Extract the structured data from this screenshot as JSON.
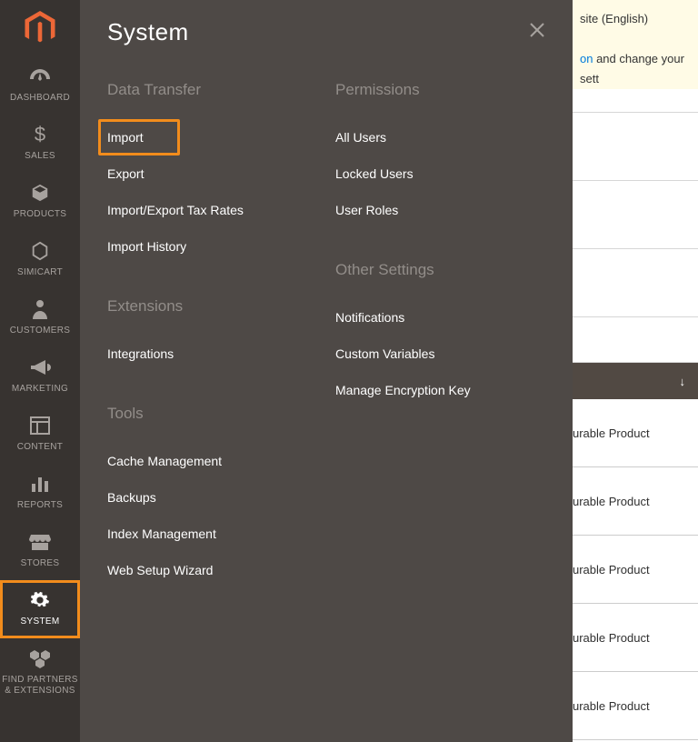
{
  "nav": {
    "items": [
      {
        "id": "dashboard",
        "label": "DASHBOARD"
      },
      {
        "id": "sales",
        "label": "SALES"
      },
      {
        "id": "products",
        "label": "PRODUCTS"
      },
      {
        "id": "simicart",
        "label": "SIMICART"
      },
      {
        "id": "customers",
        "label": "CUSTOMERS"
      },
      {
        "id": "marketing",
        "label": "MARKETING"
      },
      {
        "id": "content",
        "label": "CONTENT"
      },
      {
        "id": "reports",
        "label": "REPORTS"
      },
      {
        "id": "stores",
        "label": "STORES"
      },
      {
        "id": "system",
        "label": "SYSTEM"
      },
      {
        "id": "find-partners",
        "label": "FIND PARTNERS\n& EXTENSIONS"
      }
    ]
  },
  "flyout": {
    "title": "System",
    "left_sections": [
      {
        "heading": "Data Transfer",
        "items": [
          "Import",
          "Export",
          "Import/Export Tax Rates",
          "Import History"
        ]
      },
      {
        "heading": "Extensions",
        "items": [
          "Integrations"
        ]
      },
      {
        "heading": "Tools",
        "items": [
          "Cache Management",
          "Backups",
          "Index Management",
          "Web Setup Wizard"
        ]
      }
    ],
    "right_sections": [
      {
        "heading": "Permissions",
        "items": [
          "All Users",
          "Locked Users",
          "User Roles"
        ]
      },
      {
        "heading": "Other Settings",
        "items": [
          "Notifications",
          "Custom Variables",
          "Manage Encryption Key"
        ]
      }
    ],
    "highlight_item": "Import"
  },
  "bg": {
    "notice_line1_suffix": "site (English)",
    "notice_link": "on",
    "notice_line2_suffix": " and change your sett",
    "col_arrow": "↓",
    "row_text": "urable Product"
  }
}
